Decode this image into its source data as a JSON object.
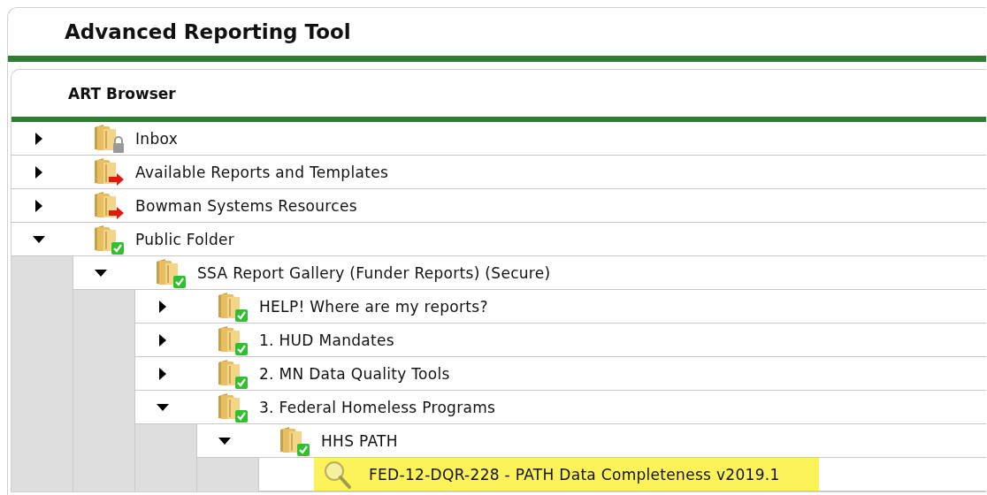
{
  "page_title": "Advanced Reporting Tool",
  "panel_title": "ART Browser",
  "tree": [
    {
      "kind": "locked_folder",
      "label": "Inbox",
      "expanded": false
    },
    {
      "kind": "linked_folder",
      "label": "Available Reports and Templates",
      "expanded": false
    },
    {
      "kind": "linked_folder",
      "label": "Bowman Systems Resources",
      "expanded": false
    },
    {
      "kind": "checked_folder",
      "label": "Public Folder",
      "expanded": true,
      "children": [
        {
          "kind": "checked_folder",
          "label": "SSA Report Gallery (Funder Reports) (Secure)",
          "expanded": true,
          "children": [
            {
              "kind": "checked_folder",
              "label": "HELP! Where are my reports?",
              "expanded": false
            },
            {
              "kind": "checked_folder",
              "label": "1. HUD Mandates",
              "expanded": false
            },
            {
              "kind": "checked_folder",
              "label": "2. MN Data Quality Tools",
              "expanded": false
            },
            {
              "kind": "checked_folder",
              "label": "3. Federal Homeless Programs",
              "expanded": true,
              "children": [
                {
                  "kind": "checked_folder",
                  "label": "HHS PATH",
                  "expanded": true,
                  "children": [
                    {
                      "kind": "report",
                      "label": "FED-12-DQR-228 - PATH Data Completeness v2019.1",
                      "selected": true
                    }
                  ]
                }
              ]
            }
          ]
        }
      ]
    }
  ]
}
